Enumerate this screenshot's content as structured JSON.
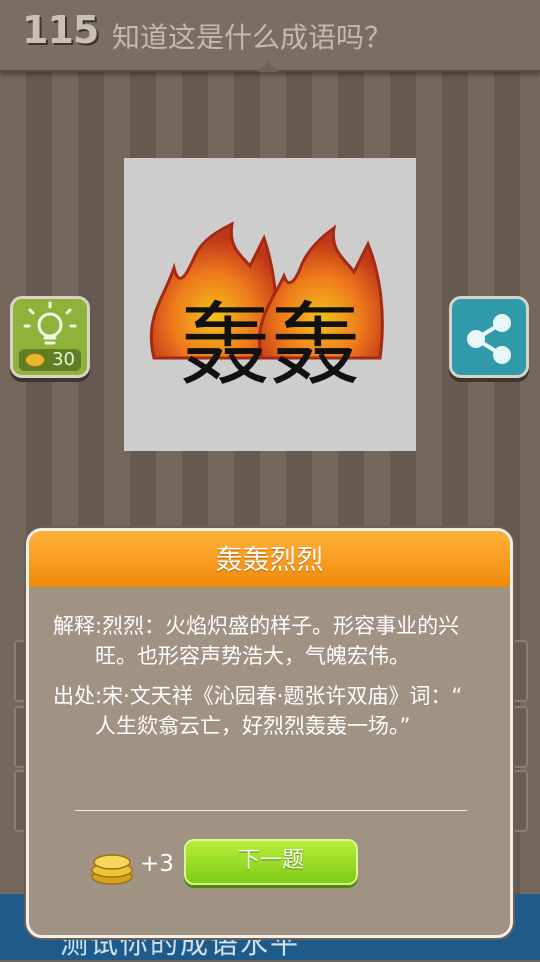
{
  "header": {
    "level": "115",
    "question": "知道这是什么成语吗？"
  },
  "hint": {
    "cost": "30"
  },
  "puzzle": {
    "characters": "轰轰"
  },
  "bottom_banner": {
    "text": "测试你的成语水平"
  },
  "dialog": {
    "title": "轰轰烈烈",
    "explain_line1": "解释:烈烈：火焰炽盛的样子。形容事业的兴",
    "explain_line2": "　　旺。也形容声势浩大，气魄宏伟。",
    "source_line1": "出处:宋·文天祥《沁园春·题张许双庙》词：“",
    "source_line2": "　　人生欻翕云亡，好烈烈轰轰一场。”",
    "reward": "+3",
    "next_label": "下一题"
  },
  "colors": {
    "title_orange": "#f08a0a",
    "next_green": "#8fd11e",
    "hint_green": "#8fb33a",
    "share_teal": "#2f9aaa"
  }
}
